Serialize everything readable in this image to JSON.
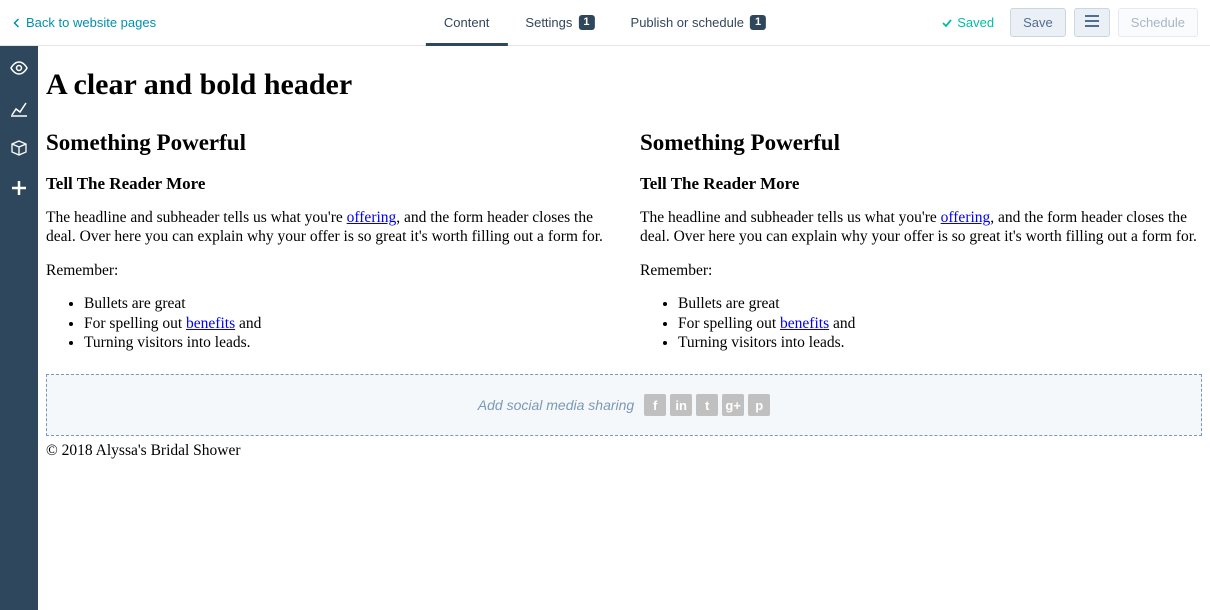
{
  "top": {
    "back_label": "Back to website pages",
    "tabs": [
      {
        "label": "Content",
        "badge": null,
        "active": true
      },
      {
        "label": "Settings",
        "badge": "1",
        "active": false
      },
      {
        "label": "Publish or schedule",
        "badge": "1",
        "active": false
      }
    ],
    "saved_label": "Saved",
    "save_button": "Save",
    "schedule_button": "Schedule"
  },
  "page": {
    "header": "A clear and bold header",
    "columns": [
      {
        "title": "Something Powerful",
        "subtitle": "Tell The Reader More",
        "para_before_link": "The headline and subheader tells us what you're ",
        "link1_text": "offering",
        "para_after_link": ", and the form header closes the deal. Over here you can explain why your offer is so great it's worth filling out a form for.",
        "remember_label": "Remember:",
        "bullets": [
          {
            "before": "Bullets are great",
            "link": null,
            "after": ""
          },
          {
            "before": "For spelling out ",
            "link": "benefits",
            "after": " and"
          },
          {
            "before": "Turning visitors into leads.",
            "link": null,
            "after": ""
          }
        ]
      },
      {
        "title": "Something Powerful",
        "subtitle": "Tell The Reader More",
        "para_before_link": "The headline and subheader tells us what you're ",
        "link1_text": "offering",
        "para_after_link": ", and the form header closes the deal. Over here you can explain why your offer is so great it's worth filling out a form for.",
        "remember_label": "Remember:",
        "bullets": [
          {
            "before": "Bullets are great",
            "link": null,
            "after": ""
          },
          {
            "before": "For spelling out ",
            "link": "benefits",
            "after": " and"
          },
          {
            "before": "Turning visitors into leads.",
            "link": null,
            "after": ""
          }
        ]
      }
    ],
    "social_placeholder": "Add social media sharing",
    "social_icons": [
      "f",
      "in",
      "t",
      "g+",
      "p"
    ],
    "footer_text": "© 2018 Alyssa's Bridal Shower"
  }
}
